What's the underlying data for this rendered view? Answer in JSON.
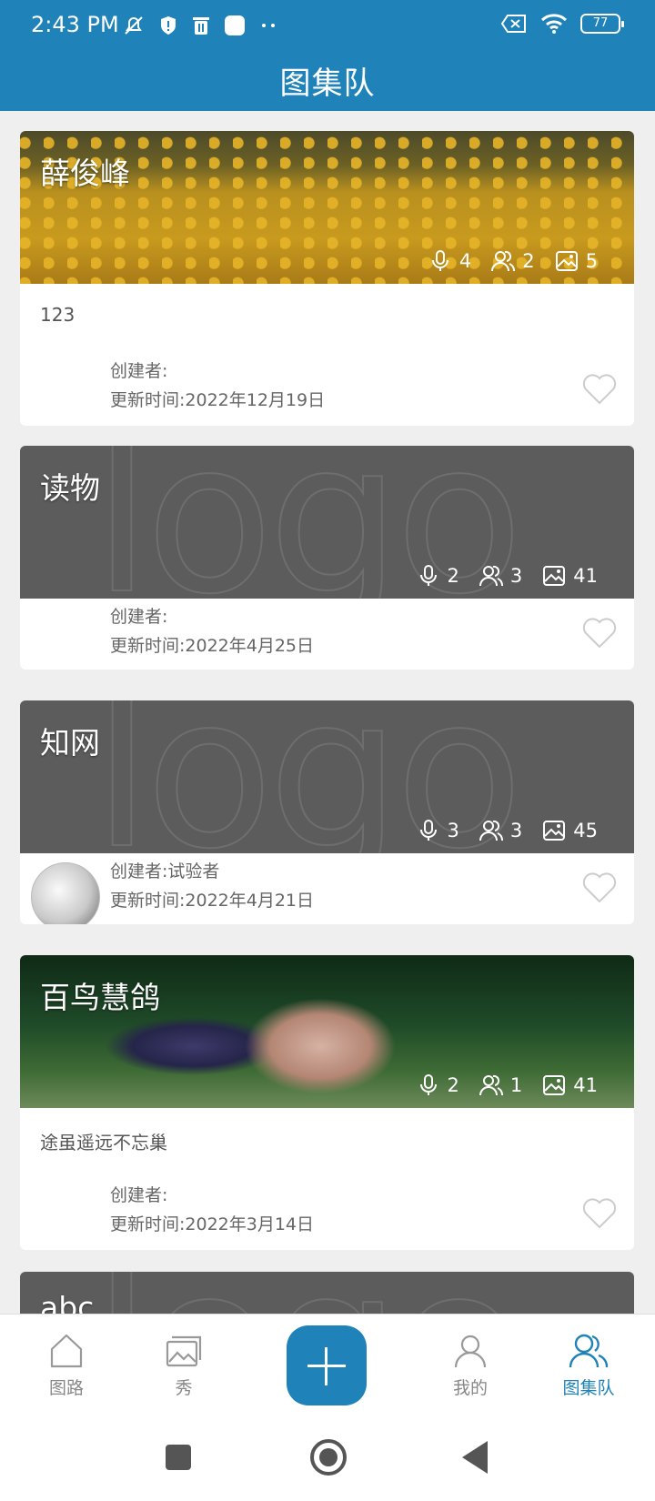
{
  "status_bar": {
    "time": "2:43 PM",
    "battery": "77"
  },
  "header": {
    "title": "图集队"
  },
  "cards": [
    {
      "name": "薛俊峰",
      "mic": "4",
      "members": "2",
      "images": "5",
      "desc": "123",
      "creator": "创建者:",
      "updated": "更新时间:2022年12月19日"
    },
    {
      "name": "读物",
      "mic": "2",
      "members": "3",
      "images": "41",
      "creator": "创建者:",
      "updated": "更新时间:2022年4月25日"
    },
    {
      "name": "知网",
      "mic": "3",
      "members": "3",
      "images": "45",
      "creator": "创建者:试验者",
      "updated": "更新时间:2022年4月21日"
    },
    {
      "name": "百鸟慧鸽",
      "mic": "2",
      "members": "1",
      "images": "41",
      "desc": "途虽遥远不忘巢",
      "creator": "创建者:",
      "updated": "更新时间:2022年3月14日"
    },
    {
      "name": "abc"
    }
  ],
  "cover_watermark": "logo",
  "bottom_nav": {
    "items": [
      {
        "label": "图路"
      },
      {
        "label": "秀"
      },
      {
        "label": "我的"
      },
      {
        "label": "图集队"
      }
    ],
    "active": "图集队"
  },
  "colors": {
    "accent": "#1f82b8"
  }
}
